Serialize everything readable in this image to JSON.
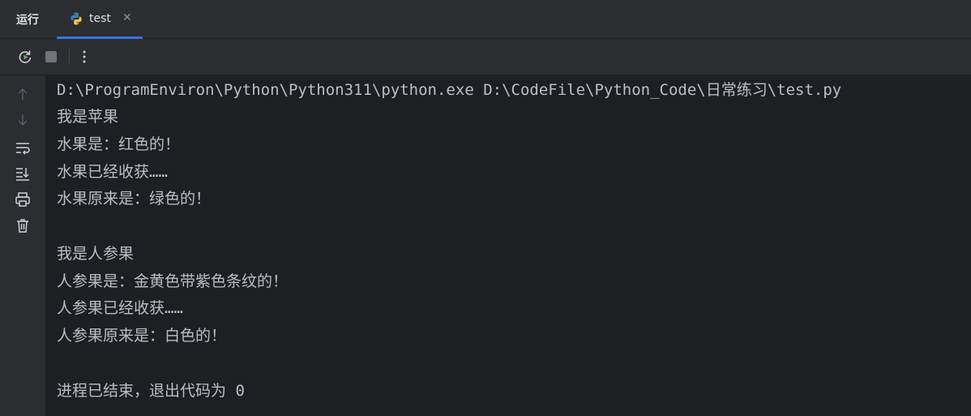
{
  "panel": {
    "title": "运行"
  },
  "tab": {
    "label": "test",
    "icon": "python-icon",
    "close": "✕",
    "accent": "#3574f0"
  },
  "toolbar": {
    "rerun_icon": "rerun-icon",
    "stop_icon": "stop-icon",
    "more_icon": "more-vertical-icon"
  },
  "gutter": {
    "icons": [
      "arrow-up-icon",
      "arrow-down-icon",
      "soft-wrap-icon",
      "scroll-to-end-icon",
      "print-icon",
      "trash-icon"
    ]
  },
  "console": {
    "lines": [
      "D:\\ProgramEnviron\\Python\\Python311\\python.exe D:\\CodeFile\\Python_Code\\日常练习\\test.py",
      "我是苹果",
      "水果是：红色的！",
      "水果已经收获……",
      "水果原来是：绿色的！",
      "",
      "我是人参果",
      "人参果是：金黄色带紫色条纹的！",
      "人参果已经收获……",
      "人参果原来是：白色的！",
      "",
      "进程已结束，退出代码为 0"
    ]
  },
  "colors": {
    "background": "#1e1f22",
    "panel": "#2b2d30",
    "text": "#bcbec4",
    "accent": "#3574f0"
  }
}
